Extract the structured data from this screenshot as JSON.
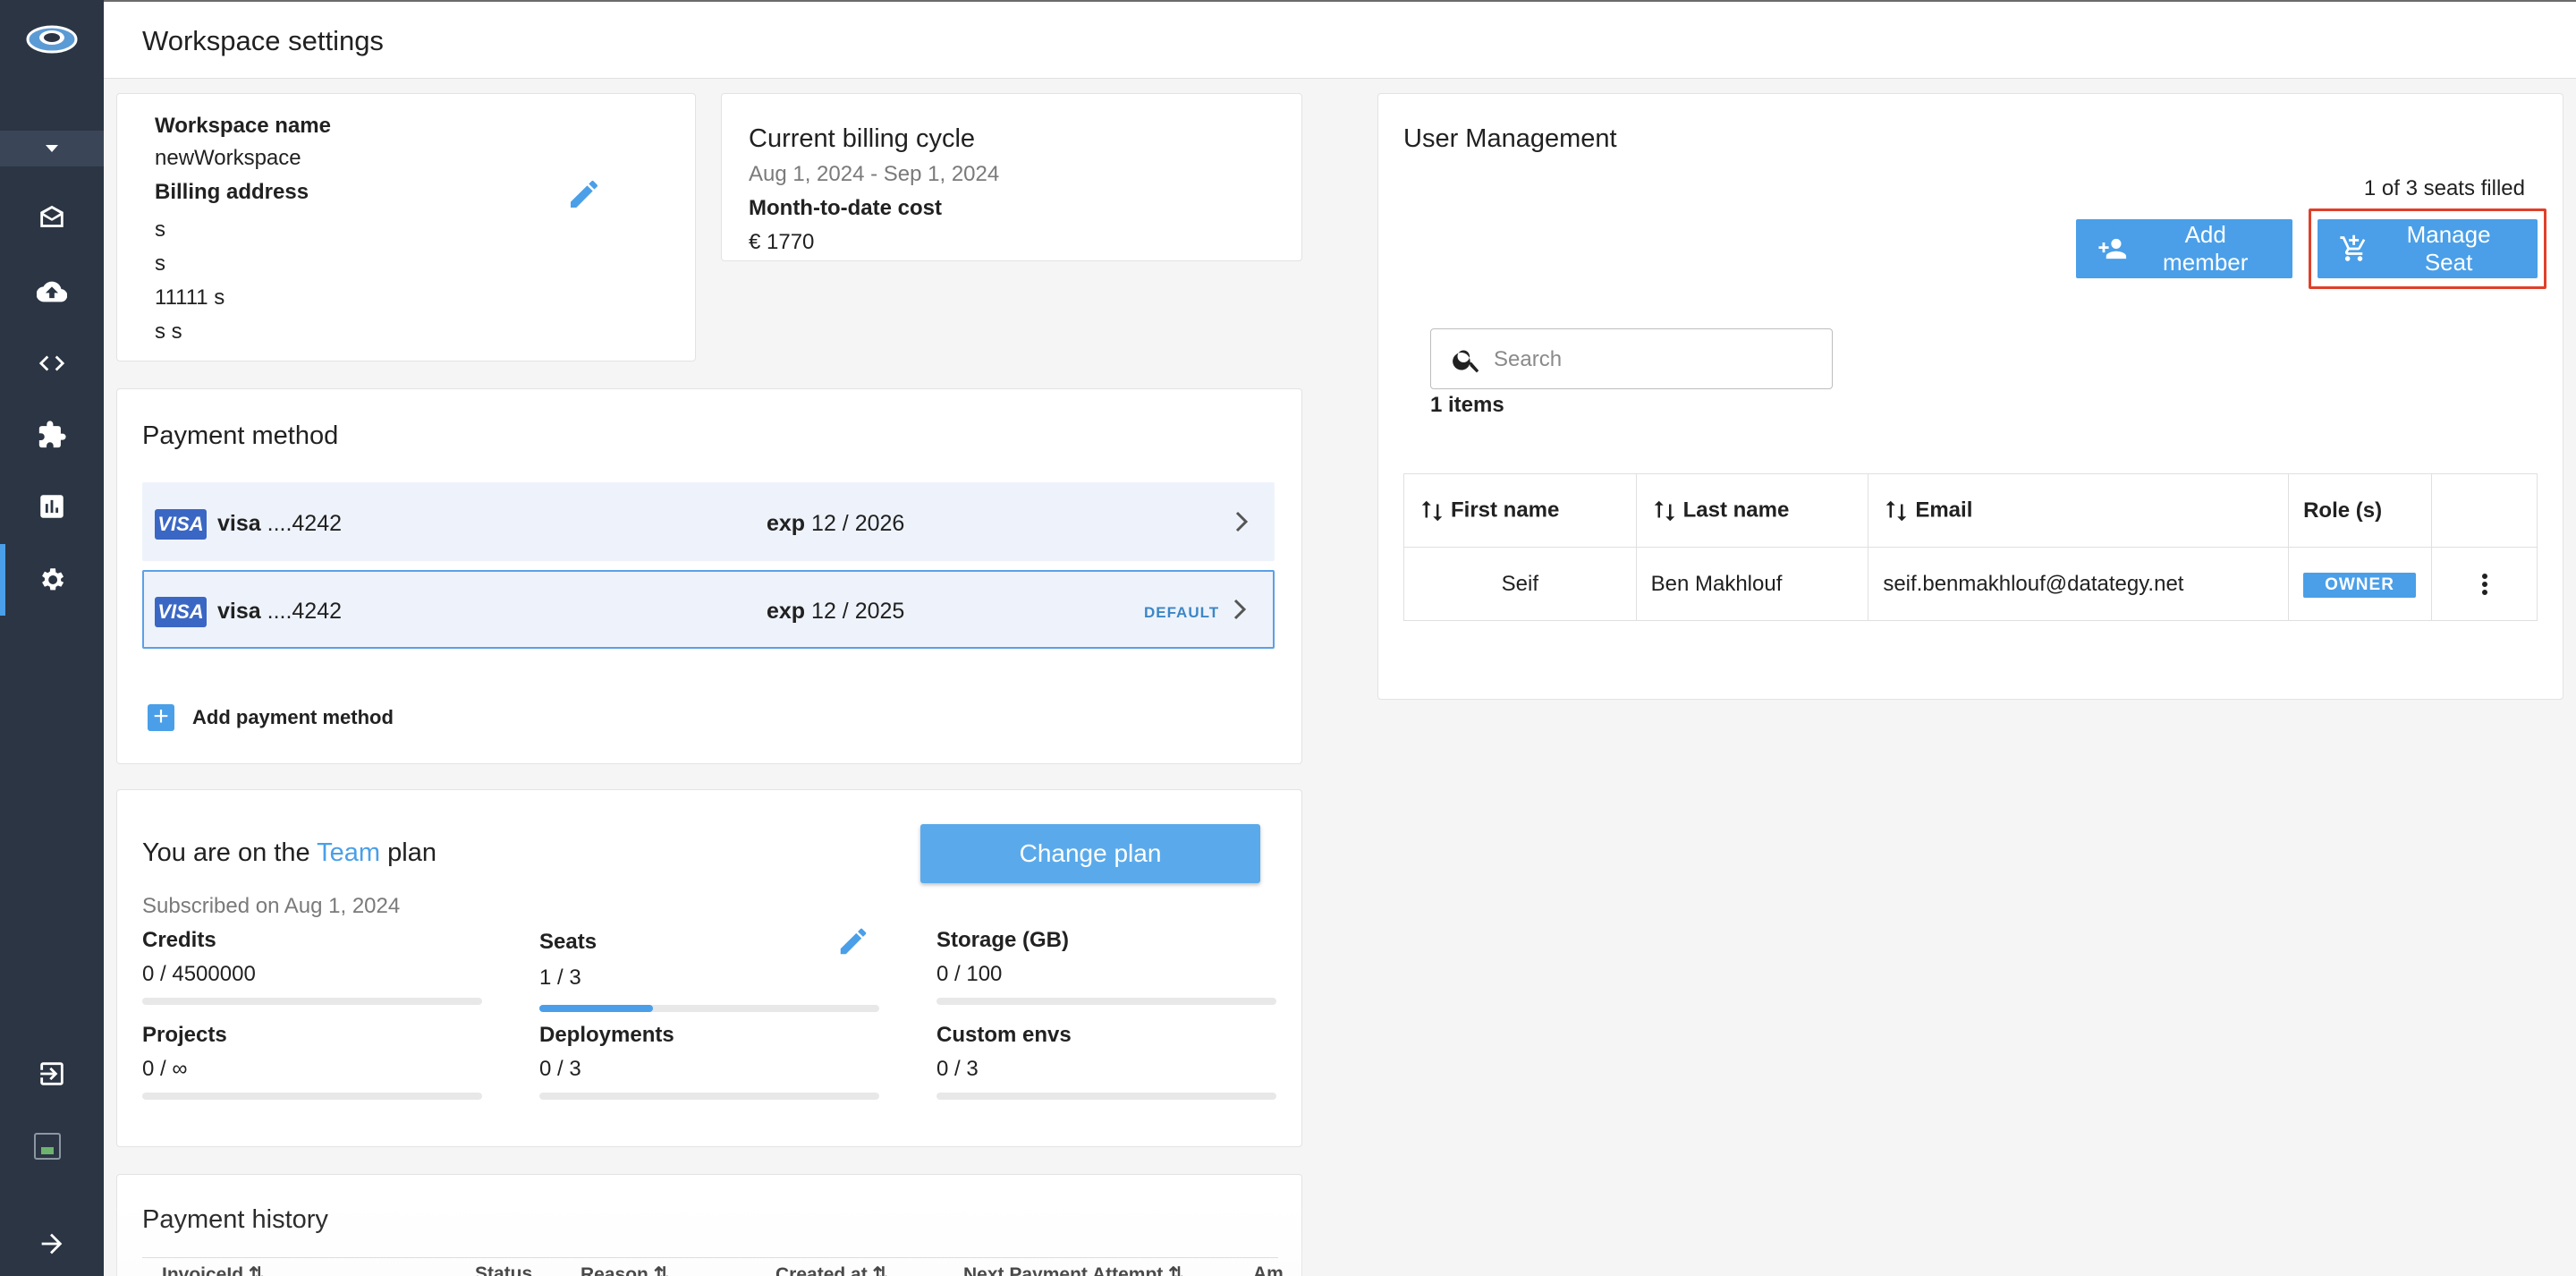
{
  "header": {
    "title": "Workspace settings"
  },
  "sidebar": {
    "items": [
      {
        "icon": "inbox-icon"
      },
      {
        "icon": "cloud-upload-icon"
      },
      {
        "icon": "code-icon"
      },
      {
        "icon": "puzzle-icon"
      },
      {
        "icon": "chart-icon"
      },
      {
        "icon": "gear-icon",
        "active": true
      }
    ]
  },
  "workspace": {
    "name_label": "Workspace name",
    "name": "newWorkspace",
    "billing_label": "Billing address",
    "address": [
      "s",
      "s",
      "11111 s",
      "s s"
    ]
  },
  "billing": {
    "title": "Current billing cycle",
    "cycle": "Aug 1, 2024 - Sep 1, 2024",
    "cost_label": "Month-to-date cost",
    "cost": "€ 1770"
  },
  "payment": {
    "title": "Payment method",
    "cards": [
      {
        "brand": "VISA",
        "label": "visa",
        "number": "....4242",
        "exp_label": "exp",
        "exp": "12 / 2026",
        "default": ""
      },
      {
        "brand": "VISA",
        "label": "visa",
        "number": "....4242",
        "exp_label": "exp",
        "exp": "12 / 2025",
        "default": "DEFAULT"
      }
    ],
    "add_label": "Add payment method"
  },
  "plan": {
    "prefix": "You are on the",
    "name": "Team",
    "suffix": "plan",
    "change_label": "Change plan",
    "subscribed": "Subscribed on Aug 1, 2024",
    "stats": [
      {
        "label": "Credits",
        "value": "0 / 4500000",
        "fill": 0
      },
      {
        "label": "Seats",
        "value": "1 / 3",
        "fill": 0.333
      },
      {
        "label": "Storage (GB)",
        "value": "0 / 100",
        "fill": 0
      },
      {
        "label": "Projects",
        "value": "0 / ∞",
        "fill": 0
      },
      {
        "label": "Deployments",
        "value": "0 / 3",
        "fill": 0
      },
      {
        "label": "Custom envs",
        "value": "0 / 3",
        "fill": 0
      }
    ]
  },
  "history": {
    "title": "Payment history",
    "columns": [
      "InvoiceId",
      "Status",
      "Reason",
      "Created at",
      "Next Payment Attempt",
      "Am"
    ]
  },
  "users": {
    "title": "User Management",
    "seats_filled": "1 of 3 seats filled",
    "add_member": "Add member",
    "manage_seat": "Manage Seat",
    "search_placeholder": "Search",
    "items_count": "1 items",
    "columns": [
      "First name",
      "Last name",
      "Email",
      "Role (s)"
    ],
    "rows": [
      {
        "first": "Seif",
        "last": "Ben Makhlouf",
        "email": "seif.benmakhlouf@datategy.net",
        "role": "OWNER"
      }
    ]
  },
  "colors": {
    "accent": "#4a9fe8",
    "sidebar": "#2b3543",
    "highlight": "#e0402a"
  }
}
